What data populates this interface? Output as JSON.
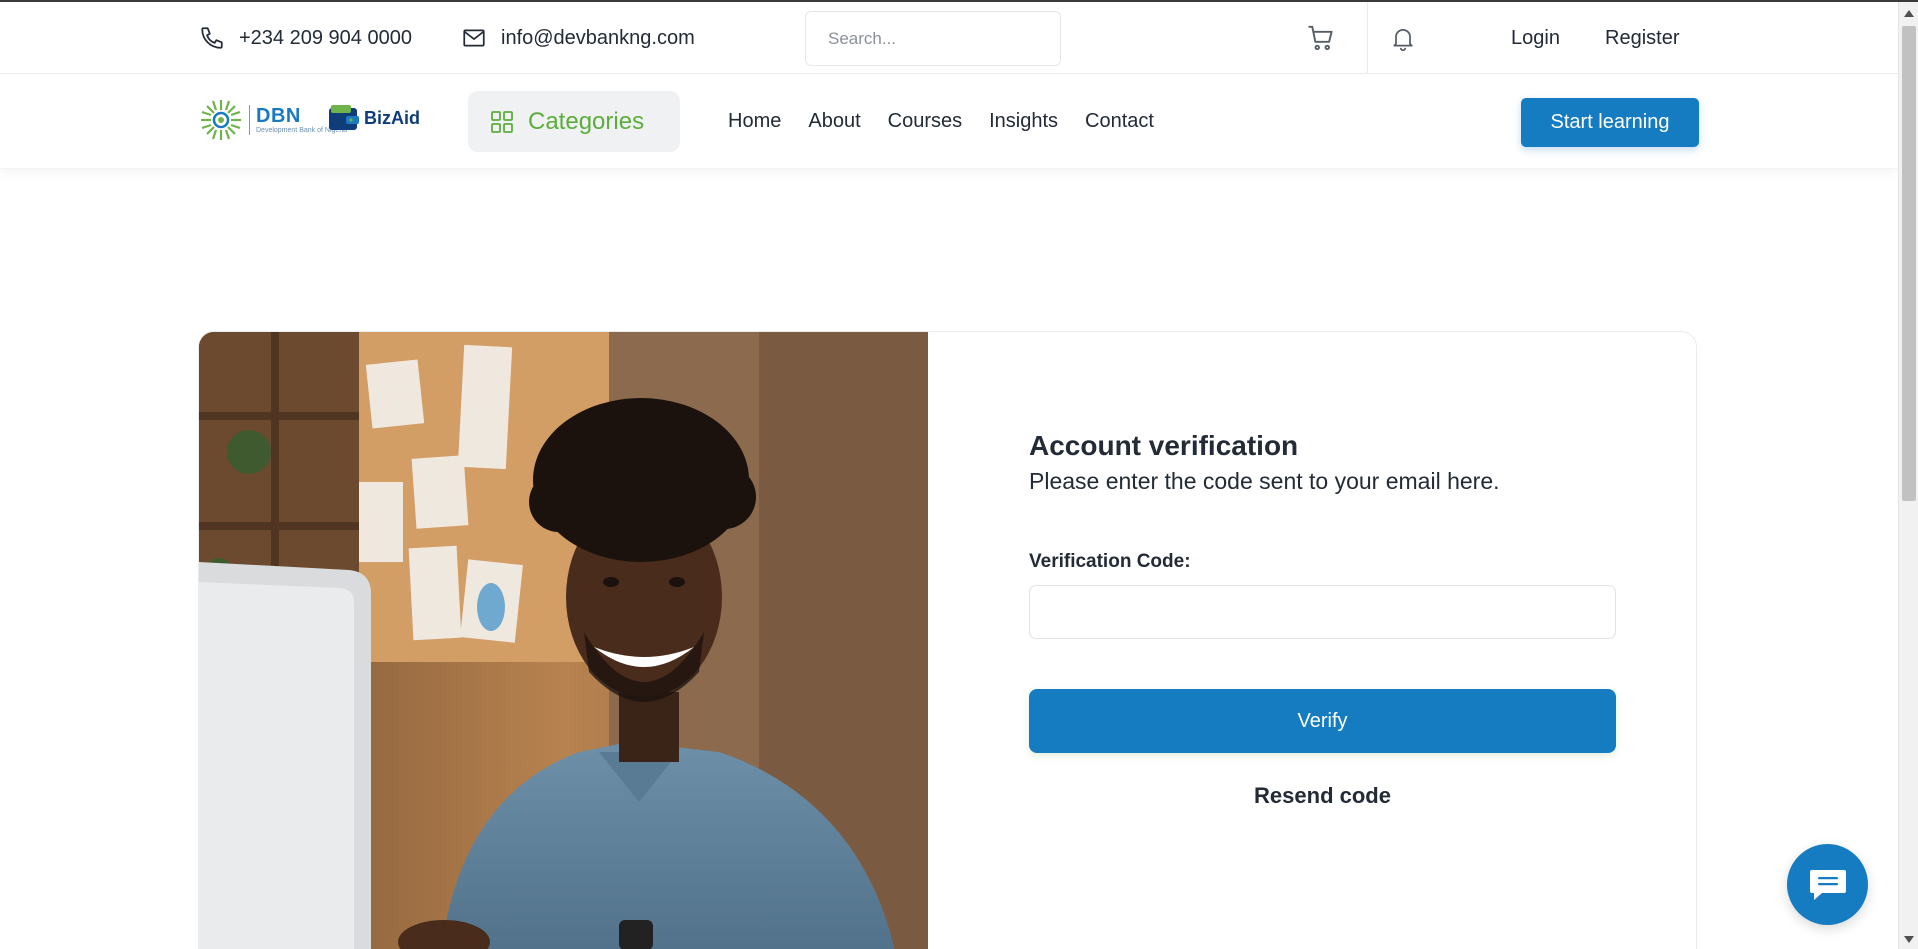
{
  "topbar": {
    "phone": "+234 209 904 0000",
    "email": "info@devbankng.com",
    "search_placeholder": "Search...",
    "login": "Login",
    "register": "Register"
  },
  "navbar": {
    "logo_dbn": "DBN",
    "logo_dbn_sub": "Development Bank of Nigeria",
    "logo_bizaid": "BizAid",
    "categories": "Categories",
    "links": [
      "Home",
      "About",
      "Courses",
      "Insights",
      "Contact"
    ],
    "start_learning": "Start learning"
  },
  "form": {
    "title": "Account verification",
    "subtitle": "Please enter the code sent to your email here.",
    "code_label": "Verification Code:",
    "code_value": "",
    "verify": "Verify",
    "resend": "Resend code"
  },
  "colors": {
    "primary": "#157cc2",
    "accent_green": "#5cae3c"
  },
  "icons": {
    "phone": "phone-icon",
    "email": "mail-icon",
    "search": "search-icon",
    "cart": "cart-icon",
    "bell": "bell-icon",
    "categories": "grid-icon",
    "chat": "chat-icon"
  }
}
